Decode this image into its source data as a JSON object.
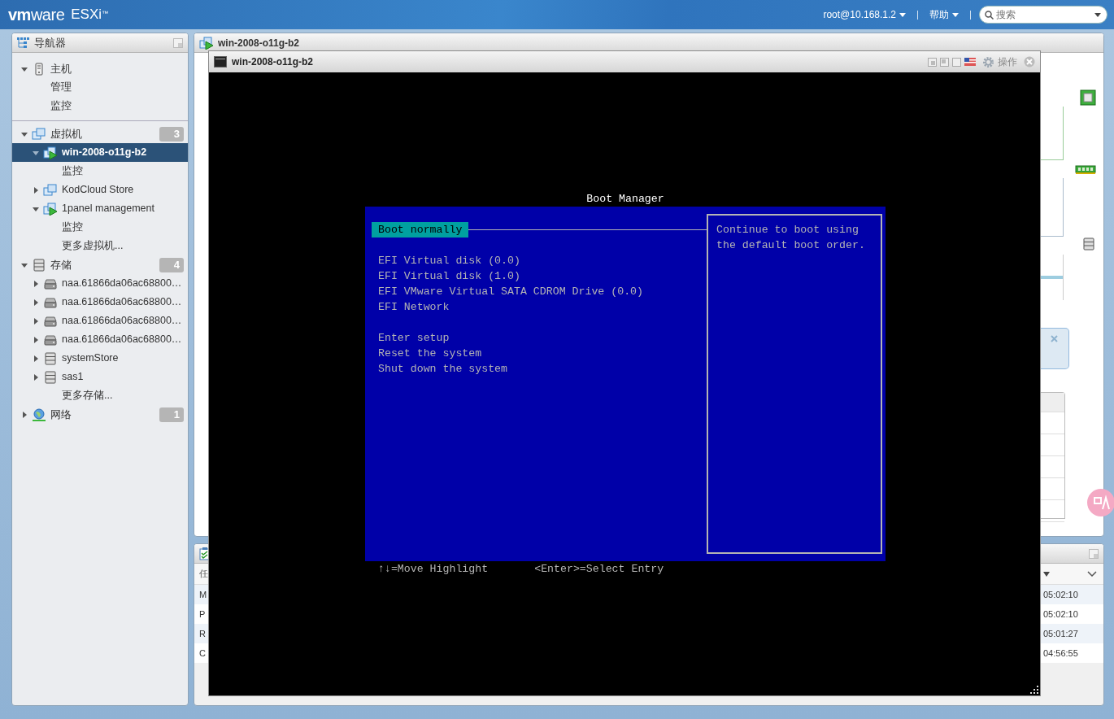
{
  "header": {
    "brand": "**vm**ware",
    "product": "ESXi",
    "trademark": "™",
    "user": "root@10.168.1.2",
    "help": "帮助",
    "search": {
      "placeholder": "搜索"
    }
  },
  "navigator": {
    "title": "导航器",
    "items": [
      {
        "label": "主机",
        "kind": "host",
        "expanded": true,
        "selected": false,
        "children": [
          {
            "label": "管理",
            "selected": false
          },
          {
            "label": "监控",
            "selected": false
          }
        ]
      },
      {
        "label": "虚拟机",
        "kind": "vm",
        "expanded": true,
        "selected": false,
        "count": "3",
        "children": [
          {
            "label": "win-2008-o11g-b2",
            "kind": "vm-on",
            "expanded": true,
            "selected": true,
            "children": [
              {
                "label": "监控",
                "selected": false
              }
            ]
          },
          {
            "label": "KodCloud Store",
            "kind": "vm",
            "expanded": false,
            "selected": false
          },
          {
            "label": "1panel management",
            "kind": "vm-on",
            "expanded": true,
            "selected": false,
            "children": [
              {
                "label": "监控",
                "selected": false
              }
            ]
          },
          {
            "label": "更多虚拟机...",
            "selected": false
          }
        ]
      },
      {
        "label": "存储",
        "kind": "datastore",
        "expanded": true,
        "selected": false,
        "count": "4",
        "children": [
          {
            "label": "naa.61866da06ac68800…",
            "kind": "disk",
            "expanded": false,
            "selected": false
          },
          {
            "label": "naa.61866da06ac68800…",
            "kind": "disk",
            "expanded": false,
            "selected": false
          },
          {
            "label": "naa.61866da06ac68800…",
            "kind": "disk",
            "expanded": false,
            "selected": false
          },
          {
            "label": "naa.61866da06ac68800…",
            "kind": "disk",
            "expanded": false,
            "selected": false
          },
          {
            "label": "systemStore",
            "kind": "datastore",
            "expanded": false,
            "selected": false
          },
          {
            "label": "sas1",
            "kind": "datastore",
            "expanded": false,
            "selected": false
          },
          {
            "label": "更多存储...",
            "selected": false
          }
        ]
      },
      {
        "label": "网络",
        "kind": "network",
        "expanded": false,
        "selected": false,
        "count": "1"
      }
    ]
  },
  "main_panel": {
    "title": "win-2008-o11g-b2"
  },
  "console": {
    "title": "win-2008-o11g-b2",
    "actions_label": "操作",
    "screen": {
      "title": "Boot Manager",
      "groups": [
        {
          "items": [
            {
              "label": "Boot normally",
              "selected": true
            }
          ]
        },
        {
          "items": [
            {
              "label": "EFI Virtual disk (0.0)",
              "selected": false
            },
            {
              "label": "EFI Virtual disk (1.0)",
              "selected": false
            },
            {
              "label": "EFI VMware Virtual SATA CDROM Drive (0.0)",
              "selected": false
            },
            {
              "label": "EFI Network",
              "selected": false
            }
          ]
        },
        {
          "items": [
            {
              "label": "Enter setup",
              "selected": false
            },
            {
              "label": "Reset the system",
              "selected": false
            },
            {
              "label": "Shut down the system",
              "selected": false
            }
          ]
        }
      ],
      "help": "Continue to boot using the default boot order.",
      "hints": [
        "↑↓=Move Highlight",
        "<Enter>=Select Entry"
      ]
    }
  },
  "tasks": {
    "column_1_header": "任",
    "rows": [
      {
        "column_1": "M",
        "time": "05:02:10"
      },
      {
        "column_1": "P",
        "time": "05:02:10"
      },
      {
        "column_1": "R",
        "time": "05:01:27"
      },
      {
        "column_1": "C",
        "time": "04:56:55"
      }
    ]
  }
}
